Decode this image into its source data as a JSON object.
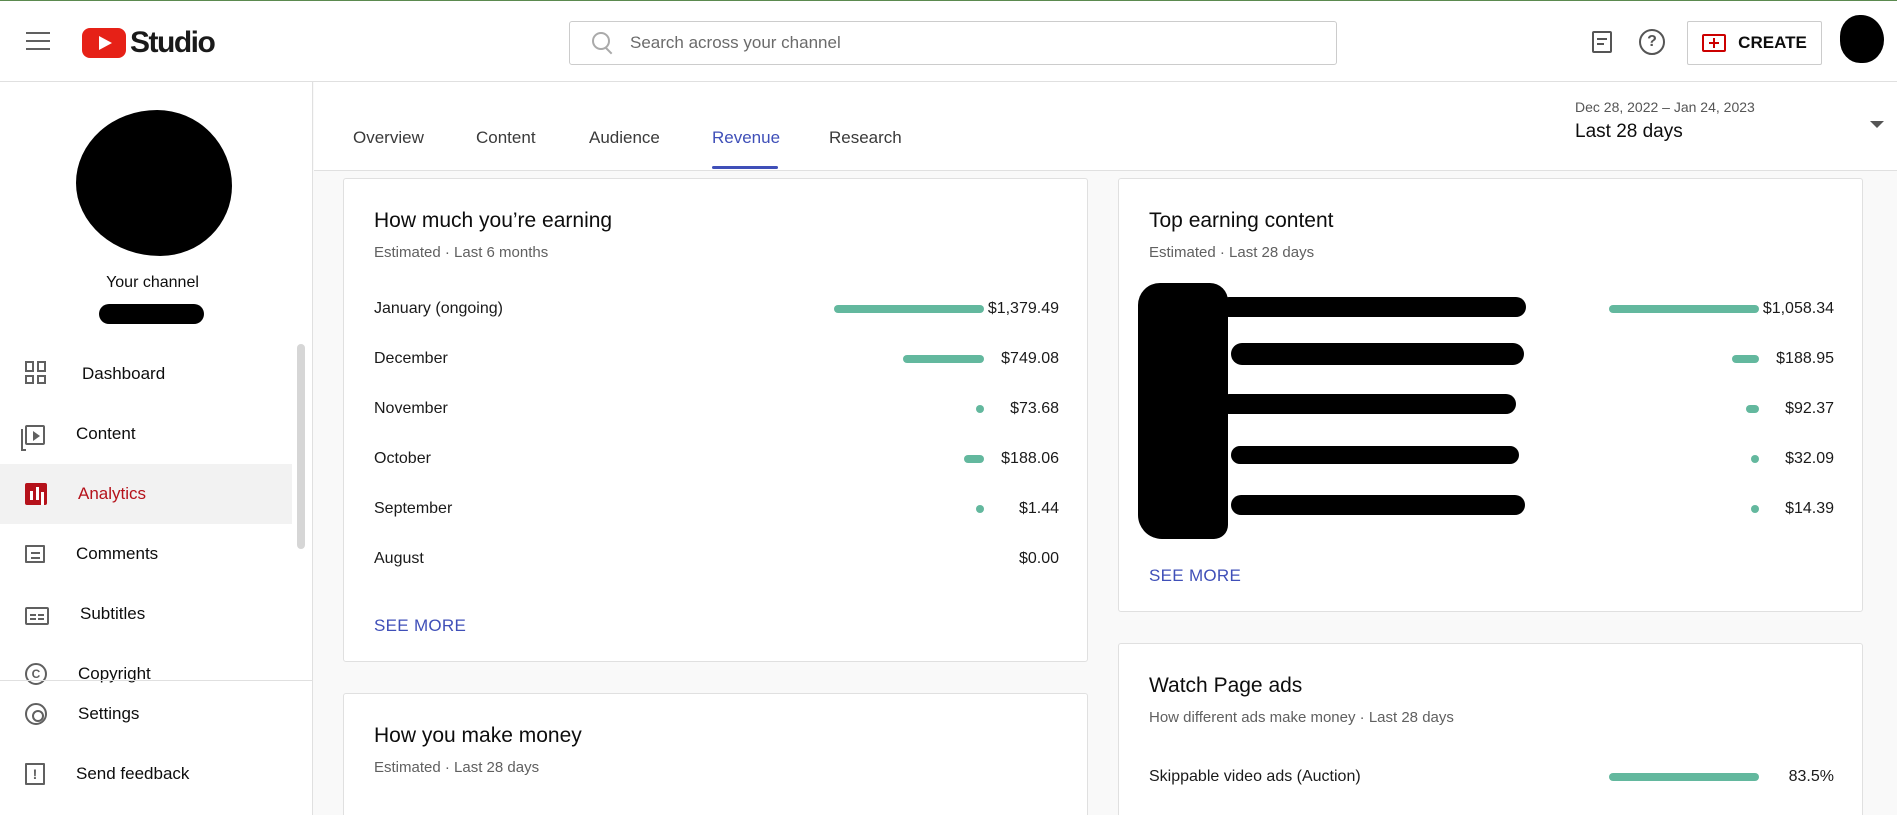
{
  "header": {
    "brand": "Studio",
    "search_placeholder": "Search across your channel",
    "create_label": "CREATE"
  },
  "sidebar": {
    "channel_title": "Your channel",
    "items": [
      {
        "label": "Dashboard",
        "icon": "dashboard-icon"
      },
      {
        "label": "Content",
        "icon": "content-icon"
      },
      {
        "label": "Analytics",
        "icon": "analytics-icon",
        "active": true
      },
      {
        "label": "Comments",
        "icon": "comments-icon"
      },
      {
        "label": "Subtitles",
        "icon": "subtitles-icon"
      },
      {
        "label": "Copyright",
        "icon": "copyright-icon"
      }
    ],
    "bottom_items": [
      {
        "label": "Settings",
        "icon": "gear-icon"
      },
      {
        "label": "Send feedback",
        "icon": "feedback-icon"
      }
    ]
  },
  "tabs": [
    {
      "label": "Overview"
    },
    {
      "label": "Content"
    },
    {
      "label": "Audience"
    },
    {
      "label": "Revenue",
      "active": true
    },
    {
      "label": "Research"
    }
  ],
  "date_range": {
    "range": "Dec 28, 2022 – Jan 24, 2023",
    "period": "Last 28 days"
  },
  "earning_card": {
    "title": "How much you’re earning",
    "subtitle": "Estimated · Last 6 months",
    "rows": [
      {
        "label": "January (ongoing)",
        "value": "$1,379.49",
        "amount": 1379.49
      },
      {
        "label": "December",
        "value": "$749.08",
        "amount": 749.08
      },
      {
        "label": "November",
        "value": "$73.68",
        "amount": 73.68
      },
      {
        "label": "October",
        "value": "$188.06",
        "amount": 188.06
      },
      {
        "label": "September",
        "value": "$1.44",
        "amount": 1.44
      },
      {
        "label": "August",
        "value": "$0.00",
        "amount": 0
      }
    ],
    "see_more": "SEE MORE"
  },
  "top_content_card": {
    "title": "Top earning content",
    "subtitle": "Estimated · Last 28 days",
    "rows": [
      {
        "value": "$1,058.34",
        "amount": 1058.34
      },
      {
        "value": "$188.95",
        "amount": 188.95
      },
      {
        "value": "$92.37",
        "amount": 92.37
      },
      {
        "value": "$32.09",
        "amount": 32.09
      },
      {
        "value": "$14.39",
        "amount": 14.39
      }
    ],
    "see_more": "SEE MORE"
  },
  "make_money_card": {
    "title": "How you make money",
    "subtitle": "Estimated · Last 28 days"
  },
  "watch_ads_card": {
    "title": "Watch Page ads",
    "subtitle": "How different ads make money · Last 28 days",
    "rows": [
      {
        "label": "Skippable video ads (Auction)",
        "value": "83.5%",
        "amount": 83.5
      }
    ]
  },
  "colors": {
    "accent": "#3f4fb8",
    "bar": "#63b89e",
    "active_nav": "#b5121b"
  }
}
